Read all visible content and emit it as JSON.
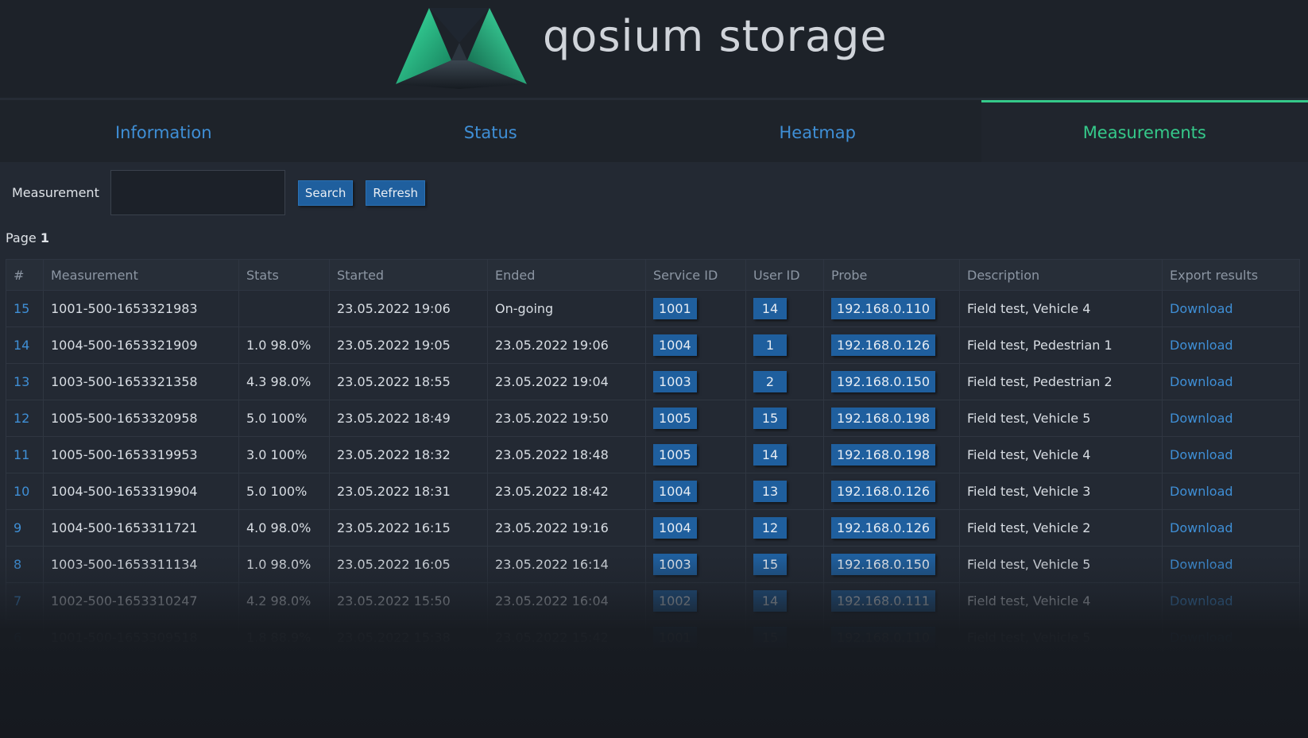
{
  "brand": {
    "name": "qosium storage"
  },
  "tabs": [
    {
      "label": "Information",
      "active": false
    },
    {
      "label": "Status",
      "active": false
    },
    {
      "label": "Heatmap",
      "active": false
    },
    {
      "label": "Measurements",
      "active": true
    }
  ],
  "search": {
    "label": "Measurement",
    "value": "",
    "search_button": "Search",
    "refresh_button": "Refresh"
  },
  "pagination": {
    "prefix": "Page",
    "current": "1"
  },
  "table": {
    "headers": [
      "#",
      "Measurement",
      "Stats",
      "Started",
      "Ended",
      "Service ID",
      "User ID",
      "Probe",
      "Description",
      "Export results"
    ],
    "rows": [
      {
        "idx": "15",
        "measurement": "1001-500-1653321983",
        "stats": "",
        "started": "23.05.2022 19:06",
        "ended": "On-going",
        "service_id": "1001",
        "user_id": "14",
        "probe": "192.168.0.110",
        "description": "Field test, Vehicle 4",
        "export": "Download"
      },
      {
        "idx": "14",
        "measurement": "1004-500-1653321909",
        "stats": "1.0 98.0%",
        "started": "23.05.2022 19:05",
        "ended": "23.05.2022 19:06",
        "service_id": "1004",
        "user_id": "1",
        "probe": "192.168.0.126",
        "description": "Field test, Pedestrian 1",
        "export": "Download"
      },
      {
        "idx": "13",
        "measurement": "1003-500-1653321358",
        "stats": "4.3 98.0%",
        "started": "23.05.2022 18:55",
        "ended": "23.05.2022 19:04",
        "service_id": "1003",
        "user_id": "2",
        "probe": "192.168.0.150",
        "description": "Field test, Pedestrian 2",
        "export": "Download"
      },
      {
        "idx": "12",
        "measurement": "1005-500-1653320958",
        "stats": "5.0 100%",
        "started": "23.05.2022 18:49",
        "ended": "23.05.2022 19:50",
        "service_id": "1005",
        "user_id": "15",
        "probe": "192.168.0.198",
        "description": "Field test, Vehicle 5",
        "export": "Download"
      },
      {
        "idx": "11",
        "measurement": "1005-500-1653319953",
        "stats": "3.0 100%",
        "started": "23.05.2022 18:32",
        "ended": "23.05.2022 18:48",
        "service_id": "1005",
        "user_id": "14",
        "probe": "192.168.0.198",
        "description": "Field test, Vehicle 4",
        "export": "Download"
      },
      {
        "idx": "10",
        "measurement": "1004-500-1653319904",
        "stats": "5.0 100%",
        "started": "23.05.2022 18:31",
        "ended": "23.05.2022 18:42",
        "service_id": "1004",
        "user_id": "13",
        "probe": "192.168.0.126",
        "description": "Field test, Vehicle 3",
        "export": "Download"
      },
      {
        "idx": "9",
        "measurement": "1004-500-1653311721",
        "stats": "4.0 98.0%",
        "started": "23.05.2022 16:15",
        "ended": "23.05.2022 19:16",
        "service_id": "1004",
        "user_id": "12",
        "probe": "192.168.0.126",
        "description": "Field test, Vehicle 2",
        "export": "Download"
      },
      {
        "idx": "8",
        "measurement": "1003-500-1653311134",
        "stats": "1.0 98.0%",
        "started": "23.05.2022 16:05",
        "ended": "23.05.2022 16:14",
        "service_id": "1003",
        "user_id": "15",
        "probe": "192.168.0.150",
        "description": "Field test, Vehicle 5",
        "export": "Download"
      },
      {
        "idx": "7",
        "measurement": "1002-500-1653310247",
        "stats": "4.2 98.0%",
        "started": "23.05.2022 15:50",
        "ended": "23.05.2022 16:04",
        "service_id": "1002",
        "user_id": "14",
        "probe": "192.168.0.111",
        "description": "Field test, Vehicle 4",
        "export": "Download"
      },
      {
        "idx": "6",
        "measurement": "1001-500-1653309518",
        "stats": "1.8 88.9%",
        "started": "23.05.2022 15:38",
        "ended": "23.05.2022 15:42",
        "service_id": "1001",
        "user_id": "15",
        "probe": "192.168.0.110",
        "description": "Field test, Vehicle 5",
        "export": "Download"
      }
    ]
  },
  "colors": {
    "accent_green": "#35c98a",
    "link_blue": "#3f8fd6",
    "chip_blue": "#1f5f9e",
    "background": "#1c2129"
  },
  "icons": {
    "logo": "qosium-logo-icon"
  }
}
